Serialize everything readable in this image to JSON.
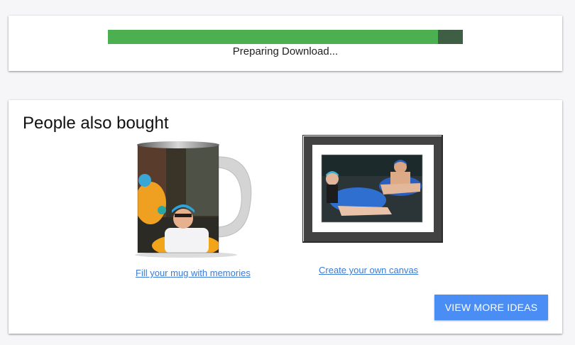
{
  "download": {
    "status_text": "Preparing Download...",
    "progress": 0.93,
    "colors": {
      "fill": "#4cb050",
      "track": "#3f5f45"
    }
  },
  "recommendations": {
    "title": "People also bought",
    "products": [
      {
        "kind": "mug-image",
        "link_text": "Fill your mug with memories"
      },
      {
        "kind": "framed-canvas-image",
        "link_text": "Create your own canvas"
      }
    ],
    "more_button_label": "VIEW MORE IDEAS",
    "colors": {
      "link": "#3a7bd5",
      "button": "#4a8ef5"
    }
  }
}
